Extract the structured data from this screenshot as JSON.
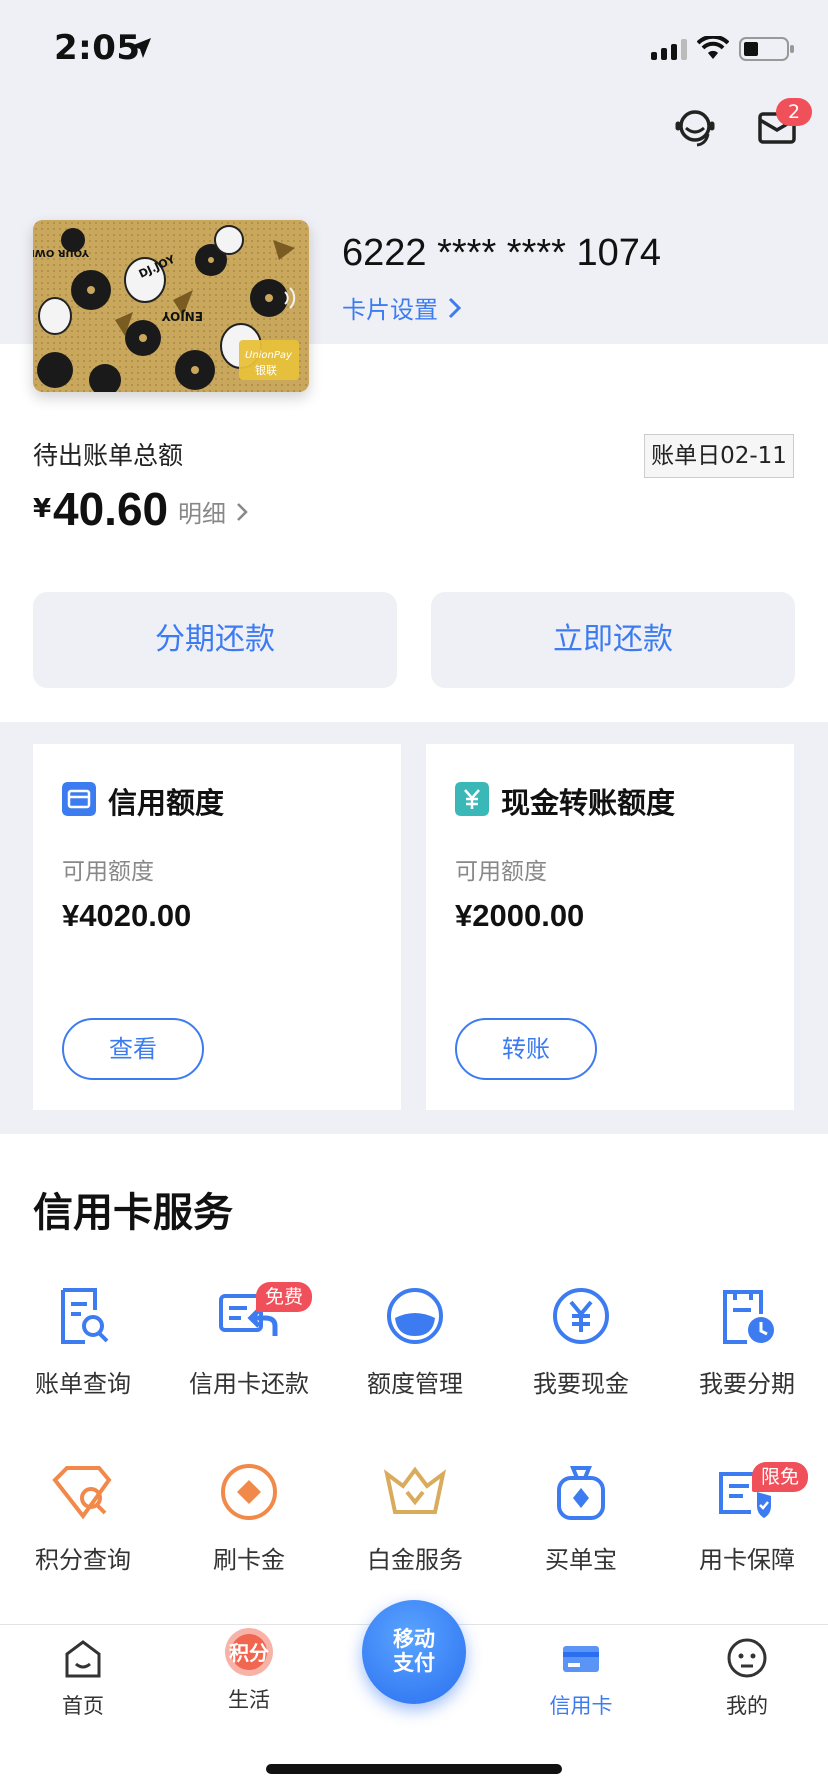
{
  "status_bar": {
    "time": "2:05"
  },
  "header": {
    "mail_badge": "2"
  },
  "card": {
    "number": "6222 **** **** 1074",
    "settings_label": "卡片设置",
    "art_text": [
      "DJ.JOY",
      "ENJOY",
      "YOUR OWN LIFE",
      "UnionPay",
      "银联"
    ]
  },
  "bill": {
    "label": "待出账单总额",
    "currency": "¥",
    "amount": "40.60",
    "detail_label": "明细",
    "bill_day": "账单日02-11"
  },
  "actions": {
    "installment_label": "分期还款",
    "repay_label": "立即还款"
  },
  "quota": [
    {
      "title": "信用额度",
      "sub": "可用额度",
      "amount": "¥4020.00",
      "button": "查看"
    },
    {
      "title": "现金转账额度",
      "sub": "可用额度",
      "amount": "¥2000.00",
      "button": "转账"
    }
  ],
  "services": {
    "title": "信用卡服务",
    "items": [
      {
        "label": "账单查询",
        "icon": "bill-search-icon"
      },
      {
        "label": "信用卡还款",
        "icon": "card-repay-icon",
        "badge": "免费"
      },
      {
        "label": "额度管理",
        "icon": "limit-gauge-icon"
      },
      {
        "label": "我要现金",
        "icon": "yuan-coin-icon"
      },
      {
        "label": "我要分期",
        "icon": "installment-clock-icon"
      },
      {
        "label": "积分查询",
        "icon": "points-tag-icon"
      },
      {
        "label": "刷卡金",
        "icon": "diamond-coin-icon"
      },
      {
        "label": "白金服务",
        "icon": "crown-icon"
      },
      {
        "label": "买单宝",
        "icon": "money-bag-icon"
      },
      {
        "label": "用卡保障",
        "icon": "card-shield-icon",
        "badge": "限免"
      }
    ]
  },
  "tabbar": {
    "items": [
      {
        "label": "首页",
        "icon": "home-icon"
      },
      {
        "label": "生活",
        "icon": "points-badge-icon",
        "icon_text": "积分"
      },
      {
        "label": "移动\n支付",
        "icon": "mobile-pay-icon"
      },
      {
        "label": "信用卡",
        "icon": "credit-card-icon"
      },
      {
        "label": "我的",
        "icon": "profile-face-icon"
      }
    ],
    "center_line1": "移动",
    "center_line2": "支付",
    "active": "信用卡"
  },
  "colors": {
    "accent": "#3d7cf0",
    "badge": "#f0505a",
    "page_bg": "#eff0f5",
    "orange": "#f0894a"
  }
}
